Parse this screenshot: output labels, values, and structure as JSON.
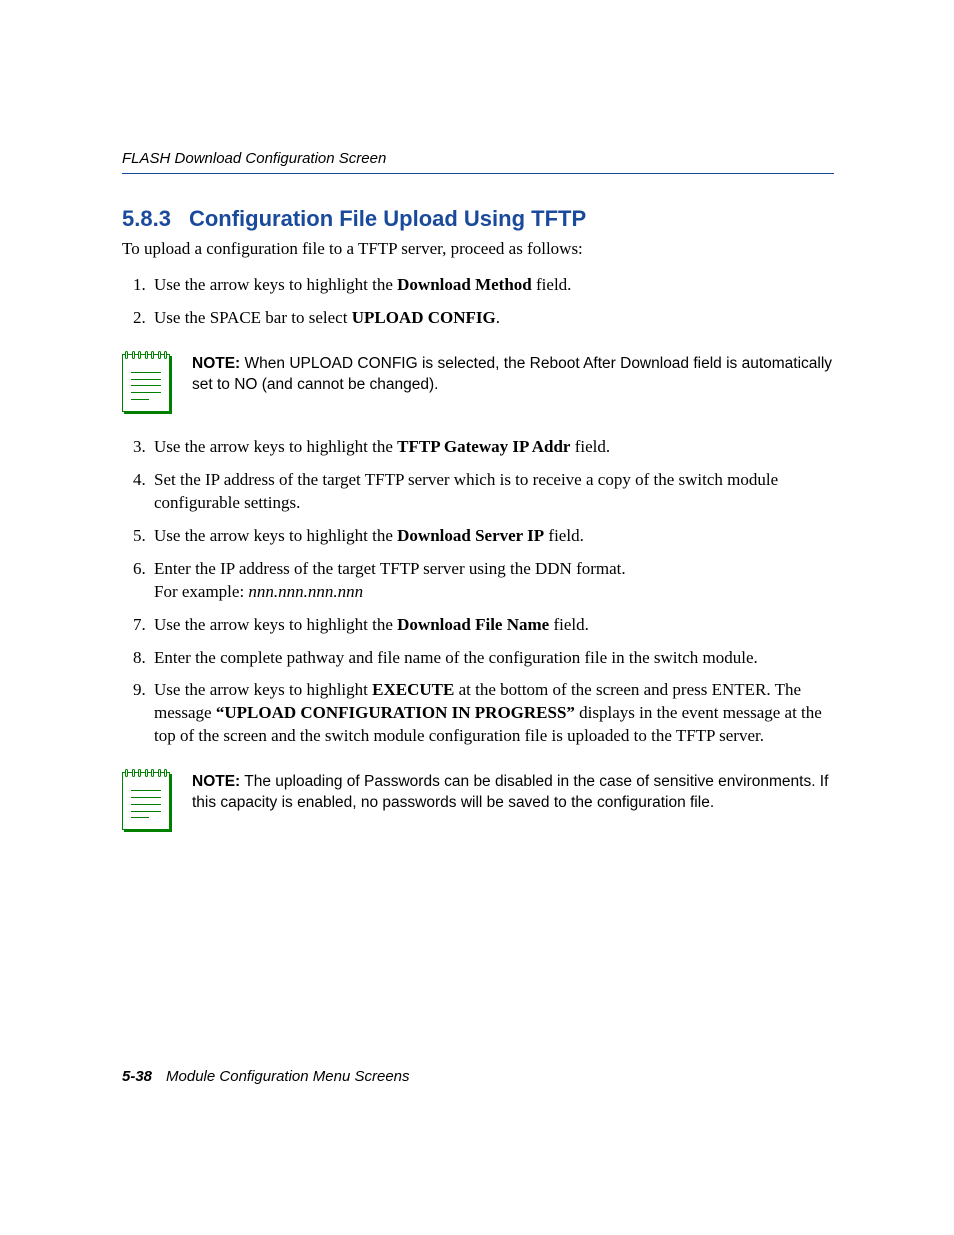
{
  "header": {
    "running_title": "FLASH Download Configuration Screen"
  },
  "section": {
    "number": "5.8.3",
    "title": "Configuration File Upload Using TFTP",
    "intro": "To upload a configuration file to a TFTP server, proceed as follows:"
  },
  "steps_a": [
    {
      "pre": "Use the arrow keys to highlight the ",
      "bold": "Download Method",
      "post": " field."
    },
    {
      "pre": "Use the SPACE bar to select ",
      "bold": "UPLOAD CONFIG",
      "post": "."
    }
  ],
  "note1": {
    "label": "NOTE:",
    "text": "  When UPLOAD CONFIG is selected, the Reboot After Download field is automatically set to NO (and cannot be changed)."
  },
  "steps_b": [
    {
      "pre": "Use the arrow keys to highlight the ",
      "bold": "TFTP Gateway IP Addr",
      "post": " field."
    },
    {
      "pre": "Set the IP address of the target TFTP server which is to receive a copy of the switch module configurable settings.",
      "bold": "",
      "post": ""
    },
    {
      "pre": "Use the arrow keys to highlight the ",
      "bold": "Download Server IP",
      "post": " field."
    },
    {
      "pre": "Enter the IP address of the target TFTP server using the DDN format.",
      "bold": "",
      "post": "",
      "sub_pre": "For example: ",
      "sub_italic": "nnn.nnn.nnn.nnn"
    },
    {
      "pre": "Use the arrow keys to highlight the ",
      "bold": "Download File Name",
      "post": " field."
    },
    {
      "pre": "Enter the complete pathway and file name of the configuration file in the switch module.",
      "bold": "",
      "post": ""
    },
    {
      "pre": "Use the arrow keys to highlight ",
      "bold": "EXECUTE",
      "post": " at the bottom of the screen and press ENTER. The message ",
      "bold2": "“UPLOAD CONFIGURATION IN PROGRESS”",
      "post2": " displays in the event message at the top of the screen and the switch module configuration file is uploaded to the TFTP server."
    }
  ],
  "note2": {
    "label": "NOTE:",
    "text": "  The uploading of Passwords can be disabled in the case of sensitive environments. If this capacity is enabled, no passwords will be saved to the configuration file."
  },
  "footer": {
    "page_number": "5-38",
    "chapter": "Module Configuration Menu Screens"
  }
}
